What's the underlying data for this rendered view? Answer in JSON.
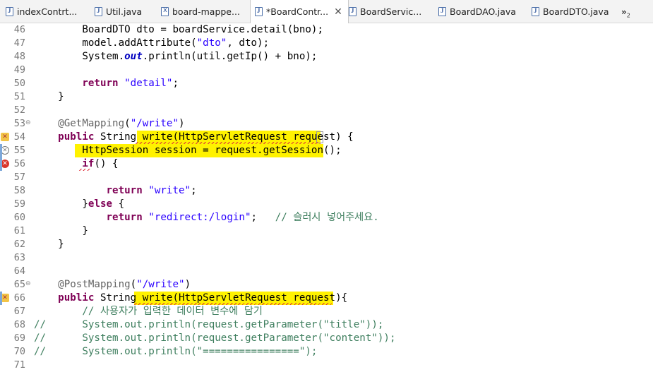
{
  "tabs": [
    {
      "label": "indexContrt...",
      "icon": "java-file-icon"
    },
    {
      "label": "Util.java",
      "icon": "java-file-icon"
    },
    {
      "label": "board-mappe...",
      "icon": "xml-file-icon"
    },
    {
      "label": "*BoardContr...",
      "icon": "java-file-icon",
      "active": true
    },
    {
      "label": "BoardServic...",
      "icon": "java-file-icon"
    },
    {
      "label": "BoardDAO.java",
      "icon": "java-file-icon"
    },
    {
      "label": "BoardDTO.java",
      "icon": "java-file-icon"
    }
  ],
  "tab_close_glyph": "✕",
  "overflow": {
    "glyph": "»",
    "count": "2"
  },
  "lines": [
    {
      "n": "46",
      "t": "        BoardDTO dto = boardService.detail(bno);"
    },
    {
      "n": "47",
      "t": "        model.addAttribute(\"dto\", dto);"
    },
    {
      "n": "48",
      "t": "        System.out.println(util.getIp() + bno);"
    },
    {
      "n": "49",
      "t": ""
    },
    {
      "n": "50",
      "t": "        return \"detail\";"
    },
    {
      "n": "51",
      "t": "    }"
    },
    {
      "n": "52",
      "t": ""
    },
    {
      "n": "53",
      "t": "    @GetMapping(\"/write\")"
    },
    {
      "n": "54",
      "t": "    public String write(HttpServletRequest request) {"
    },
    {
      "n": "55",
      "t": "        HttpSession session = request.getSession();"
    },
    {
      "n": "56",
      "t": "        if() {"
    },
    {
      "n": "57",
      "t": ""
    },
    {
      "n": "58",
      "t": "            return \"write\";"
    },
    {
      "n": "59",
      "t": "        }else {"
    },
    {
      "n": "60",
      "t": "            return \"redirect:/login\";   // 슬러시 넣어주세요."
    },
    {
      "n": "61",
      "t": "        }"
    },
    {
      "n": "62",
      "t": "    }"
    },
    {
      "n": "63",
      "t": ""
    },
    {
      "n": "64",
      "t": ""
    },
    {
      "n": "65",
      "t": "    @PostMapping(\"/write\")"
    },
    {
      "n": "66",
      "t": "    public String write(HttpServletRequest request){"
    },
    {
      "n": "67",
      "t": "        // 사용자가 입력한 데이터 변수에 담기"
    },
    {
      "n": "68",
      "t": "//      System.out.println(request.getParameter(\"title\"));"
    },
    {
      "n": "69",
      "t": "//      System.out.println(request.getParameter(\"content\"));"
    },
    {
      "n": "70",
      "t": "//      System.out.println(\"================\");"
    },
    {
      "n": "71",
      "t": ""
    }
  ],
  "gutter_markers": {
    "54": "warning-error-icon",
    "55": "info-circle-icon",
    "56": "error-icon",
    "66": "warning-error-icon"
  },
  "fold_markers": [
    "53",
    "65"
  ],
  "fold_glyph": "⊖",
  "highlight_color": "#fff200"
}
